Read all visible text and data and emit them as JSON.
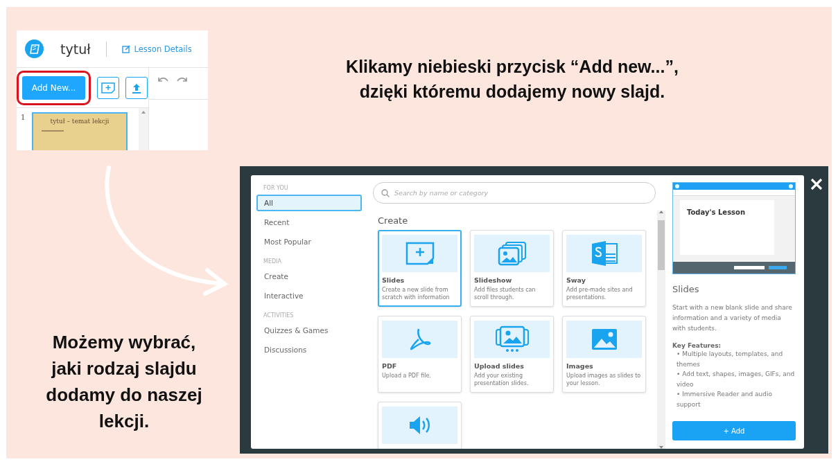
{
  "editor": {
    "title": "tytuł",
    "lesson_details": "Lesson Details",
    "add_new": {
      "label": "Add New...",
      "highlighted": true
    },
    "slides": [
      {
        "number": "1",
        "title": "tytuł – temat lekcji",
        "selected": true
      }
    ]
  },
  "top_caption": "Klikamy niebieski przycisk “Add new...”,\ndzięki któremu dodajemy nowy slajd.",
  "bottom_caption": "Możemy wybrać,\njaki rodzaj slajdu\ndodamy do naszej\nlekcji.",
  "dialog": {
    "sidebar": [
      {
        "heading": "FOR YOU",
        "items": [
          {
            "label": "All",
            "selected": true
          },
          {
            "label": "Recent",
            "selected": false
          },
          {
            "label": "Most Popular",
            "selected": false
          }
        ]
      },
      {
        "heading": "MEDIA",
        "items": [
          {
            "label": "Create",
            "selected": false
          },
          {
            "label": "Interactive",
            "selected": false
          }
        ]
      },
      {
        "heading": "ACTIVITIES",
        "items": [
          {
            "label": "Quizzes & Games",
            "selected": false
          },
          {
            "label": "Discussions",
            "selected": false
          }
        ]
      }
    ],
    "search": {
      "placeholder": "Search by name or category"
    },
    "section_title": "Create",
    "cards": [
      {
        "kind": "slides",
        "title": "Slides",
        "description": "Create a new slide from scratch with information",
        "selected": true
      },
      {
        "kind": "slideshow",
        "title": "Slideshow",
        "description": "Add files students can scroll through.",
        "selected": false
      },
      {
        "kind": "sway",
        "title": "Sway",
        "description": "Add pre-made sites and presentations.",
        "selected": false
      },
      {
        "kind": "pdf",
        "title": "PDF",
        "description": "Upload a PDF file.",
        "selected": false
      },
      {
        "kind": "upload",
        "title": "Upload slides",
        "description": "Add your existing presentation slides.",
        "selected": false
      },
      {
        "kind": "images",
        "title": "Images",
        "description": "Upload images as slides to your lesson.",
        "selected": false
      },
      {
        "kind": "audio",
        "selected": false
      }
    ],
    "preview": {
      "screen_title": "Today's Lesson",
      "title": "Slides",
      "description": "Start with a new blank slide and share information and a variety of media with students.",
      "features_heading": "Key Features:",
      "features": [
        "• Multiple layouts, templates, and themes",
        "• Add text, shapes, images, GIFs, and video",
        "• Immersive Reader and audio support"
      ],
      "add_button": "+ Add"
    }
  }
}
